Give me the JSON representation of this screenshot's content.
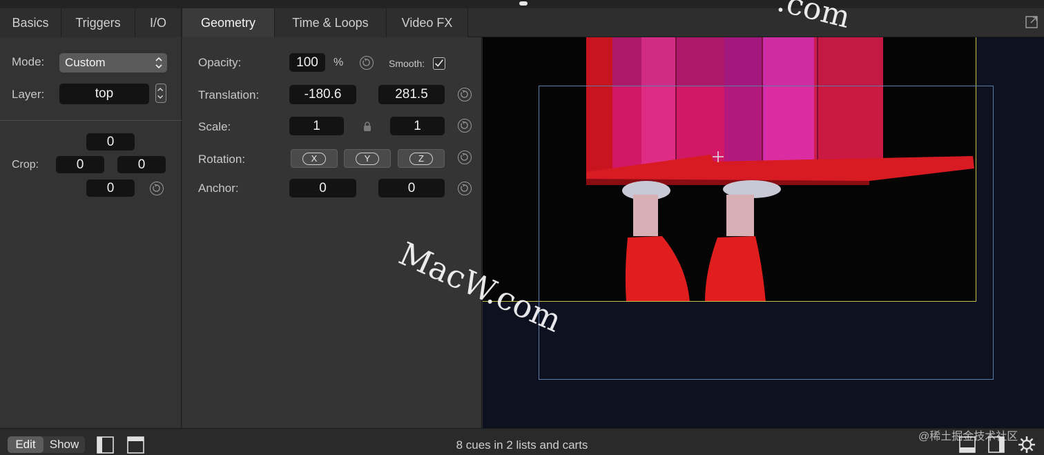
{
  "tabs": [
    {
      "label": "Basics",
      "active": false
    },
    {
      "label": "Triggers",
      "active": false
    },
    {
      "label": "I/O",
      "active": false
    },
    {
      "label": "Geometry",
      "active": true
    },
    {
      "label": "Time & Loops",
      "active": false
    },
    {
      "label": "Video FX",
      "active": false
    }
  ],
  "left": {
    "mode_label": "Mode:",
    "mode_value": "Custom",
    "layer_label": "Layer:",
    "layer_value": "top",
    "crop_label": "Crop:",
    "crop": {
      "top": "0",
      "left": "0",
      "right": "0",
      "bottom": "0"
    }
  },
  "geometry": {
    "opacity_label": "Opacity:",
    "opacity_value": "100",
    "opacity_unit": "%",
    "smooth_label": "Smooth:",
    "smooth_checked": true,
    "translation_label": "Translation:",
    "translation_x": "-180.6",
    "translation_y": "281.5",
    "scale_label": "Scale:",
    "scale_x": "1",
    "scale_y": "1",
    "rotation_label": "Rotation:",
    "rotation_buttons": [
      "X",
      "Y",
      "Z"
    ],
    "anchor_label": "Anchor:",
    "anchor_x": "0",
    "anchor_y": "0"
  },
  "bottom": {
    "edit_label": "Edit",
    "show_label": "Show",
    "status": "8 cues in 2 lists and carts"
  },
  "watermarks": {
    "main": "MacW.com",
    "top_right": ".com",
    "bottom_right": "@稀土掘金技术社区"
  },
  "colors": {
    "background": "#333333",
    "field": "#131313",
    "yellow_frame": "#c6c24a",
    "blue_frame": "#5a7ea8"
  }
}
